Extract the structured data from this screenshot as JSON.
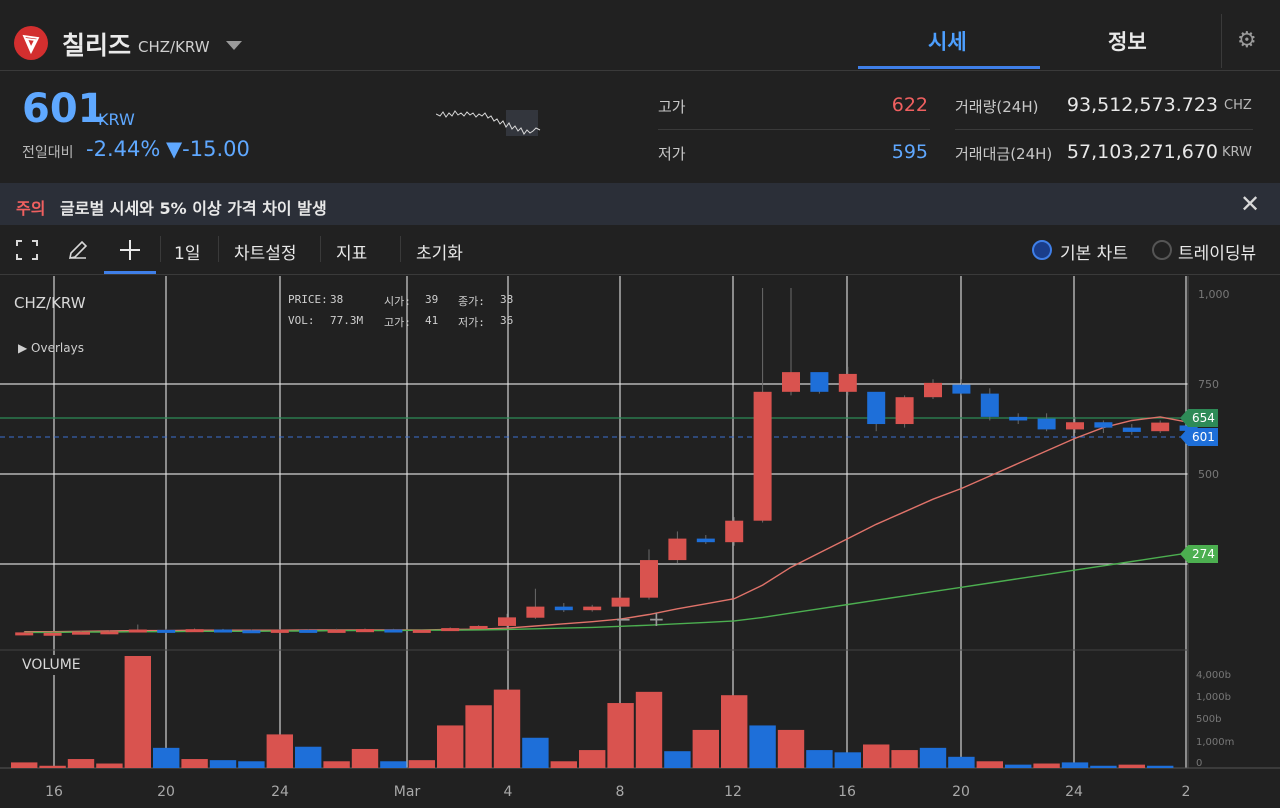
{
  "header": {
    "coin_name": "칠리즈",
    "pair": "CHZ/KRW",
    "tabs": [
      {
        "label": "시세",
        "active": true
      },
      {
        "label": "정보",
        "active": false
      }
    ]
  },
  "price": {
    "current": "601",
    "unit": "KRW",
    "change_label": "전일대비",
    "change_pct": "-2.44%",
    "change_amt": "▼-15.00",
    "high_label": "고가",
    "high": "622",
    "low_label": "저가",
    "low": "595",
    "volume_label": "거래량(24H)",
    "volume": "93,512,573.723",
    "volume_unit": "CHZ",
    "amount_label": "거래대금(24H)",
    "amount": "57,103,271,670",
    "amount_unit": "KRW"
  },
  "warning": {
    "tag": "주의",
    "text": "글로벌 시세와 5% 이상 가격 차이 발생"
  },
  "toolbar": {
    "interval": "1일",
    "chart_settings": "차트설정",
    "indicators": "지표",
    "reset": "초기화",
    "basic_chart": "기본 차트",
    "trading_view": "트레이딩뷰"
  },
  "colors": {
    "up": "#d9534f",
    "down": "#1e6fd9",
    "accent": "#3f7fe8",
    "ma_short": "#e0736a",
    "ma_long": "#4caf50",
    "hline": "#2e8b57"
  },
  "chart_data": {
    "type": "candlestick",
    "title": "CHZ/KRW",
    "overlays_label": "Overlays",
    "volume_label": "VOLUME",
    "info": {
      "price_label": "PRICE:",
      "price": "38",
      "open_label": "시가:",
      "open": "39",
      "close_label": "종가:",
      "close": "38",
      "vol_label": "VOL:",
      "vol": "77.3M",
      "high_label": "고가:",
      "high": "41",
      "low_label": "저가:",
      "low": "36"
    },
    "x_ticks": [
      "16",
      "20",
      "24",
      "Mar",
      "4",
      "8",
      "12",
      "16",
      "20",
      "24",
      "2"
    ],
    "y_ticks": [
      "1,000",
      "750",
      "500"
    ],
    "vol_ticks": [
      "4,000b",
      "1,000b",
      "500b",
      "1,000m",
      "0"
    ],
    "price_tags": {
      "ma_short": "654",
      "current": "601",
      "ma_long": "274"
    },
    "ylim": [
      0,
      1000
    ],
    "candles": [
      {
        "o": 36,
        "c": 38,
        "h": 40,
        "l": 34
      },
      {
        "o": 35,
        "c": 37,
        "h": 39,
        "l": 33
      },
      {
        "o": 37,
        "c": 40,
        "h": 42,
        "l": 36
      },
      {
        "o": 38,
        "c": 41,
        "h": 43,
        "l": 37
      },
      {
        "o": 40,
        "c": 46,
        "h": 60,
        "l": 38
      },
      {
        "o": 45,
        "c": 43,
        "h": 48,
        "l": 41
      },
      {
        "o": 44,
        "c": 47,
        "h": 49,
        "l": 42
      },
      {
        "o": 46,
        "c": 44,
        "h": 48,
        "l": 42
      },
      {
        "o": 44,
        "c": 42,
        "h": 46,
        "l": 40
      },
      {
        "o": 41,
        "c": 45,
        "h": 47,
        "l": 39
      },
      {
        "o": 45,
        "c": 43,
        "h": 47,
        "l": 41
      },
      {
        "o": 43,
        "c": 45,
        "h": 48,
        "l": 41
      },
      {
        "o": 44,
        "c": 47,
        "h": 49,
        "l": 42
      },
      {
        "o": 46,
        "c": 44,
        "h": 48,
        "l": 42
      },
      {
        "o": 44,
        "c": 45,
        "h": 47,
        "l": 42
      },
      {
        "o": 46,
        "c": 50,
        "h": 52,
        "l": 44
      },
      {
        "o": 50,
        "c": 56,
        "h": 58,
        "l": 48
      },
      {
        "o": 56,
        "c": 80,
        "h": 90,
        "l": 52
      },
      {
        "o": 79,
        "c": 110,
        "h": 160,
        "l": 76
      },
      {
        "o": 110,
        "c": 100,
        "h": 120,
        "l": 95
      },
      {
        "o": 100,
        "c": 110,
        "h": 115,
        "l": 96
      },
      {
        "o": 110,
        "c": 135,
        "h": 150,
        "l": 108
      },
      {
        "o": 135,
        "c": 240,
        "h": 270,
        "l": 130
      },
      {
        "o": 240,
        "c": 300,
        "h": 320,
        "l": 230
      },
      {
        "o": 300,
        "c": 290,
        "h": 310,
        "l": 285
      },
      {
        "o": 290,
        "c": 350,
        "h": 360,
        "l": 280
      },
      {
        "o": 350,
        "c": 710,
        "h": 1000,
        "l": 345
      },
      {
        "o": 710,
        "c": 765,
        "h": 1000,
        "l": 700
      },
      {
        "o": 765,
        "c": 710,
        "h": 760,
        "l": 705
      },
      {
        "o": 710,
        "c": 760,
        "h": 780,
        "l": 700
      },
      {
        "o": 710,
        "c": 620,
        "h": 650,
        "l": 600
      },
      {
        "o": 620,
        "c": 695,
        "h": 700,
        "l": 610
      },
      {
        "o": 695,
        "c": 735,
        "h": 745,
        "l": 690
      },
      {
        "o": 730,
        "c": 705,
        "h": 745,
        "l": 700
      },
      {
        "o": 705,
        "c": 640,
        "h": 720,
        "l": 630
      },
      {
        "o": 640,
        "c": 630,
        "h": 650,
        "l": 620
      },
      {
        "o": 635,
        "c": 605,
        "h": 650,
        "l": 600
      },
      {
        "o": 605,
        "c": 625,
        "h": 640,
        "l": 595
      },
      {
        "o": 625,
        "c": 610,
        "h": 630,
        "l": 595
      },
      {
        "o": 610,
        "c": 598,
        "h": 620,
        "l": 590
      },
      {
        "o": 600,
        "c": 624,
        "h": 630,
        "l": 595
      },
      {
        "o": 616,
        "c": 601,
        "h": 622,
        "l": 595
      }
    ],
    "volumes": [
      {
        "v": 0.05,
        "up": true
      },
      {
        "v": 0.02,
        "up": true
      },
      {
        "v": 0.08,
        "up": true
      },
      {
        "v": 0.04,
        "up": true
      },
      {
        "v": 1.0,
        "up": true
      },
      {
        "v": 0.18,
        "up": false
      },
      {
        "v": 0.08,
        "up": true
      },
      {
        "v": 0.07,
        "up": false
      },
      {
        "v": 0.06,
        "up": false
      },
      {
        "v": 0.3,
        "up": true
      },
      {
        "v": 0.19,
        "up": false
      },
      {
        "v": 0.06,
        "up": true
      },
      {
        "v": 0.17,
        "up": true
      },
      {
        "v": 0.06,
        "up": false
      },
      {
        "v": 0.07,
        "up": true
      },
      {
        "v": 0.38,
        "up": true
      },
      {
        "v": 0.56,
        "up": true
      },
      {
        "v": 0.7,
        "up": true
      },
      {
        "v": 0.27,
        "up": false
      },
      {
        "v": 0.06,
        "up": true
      },
      {
        "v": 0.16,
        "up": true
      },
      {
        "v": 0.58,
        "up": true
      },
      {
        "v": 0.68,
        "up": true
      },
      {
        "v": 0.15,
        "up": false
      },
      {
        "v": 0.34,
        "up": true
      },
      {
        "v": 0.65,
        "up": true
      },
      {
        "v": 0.38,
        "up": false
      },
      {
        "v": 0.34,
        "up": true
      },
      {
        "v": 0.16,
        "up": false
      },
      {
        "v": 0.14,
        "up": false
      },
      {
        "v": 0.21,
        "up": true
      },
      {
        "v": 0.16,
        "up": true
      },
      {
        "v": 0.18,
        "up": false
      },
      {
        "v": 0.1,
        "up": false
      },
      {
        "v": 0.06,
        "up": true
      },
      {
        "v": 0.03,
        "up": false
      },
      {
        "v": 0.04,
        "up": true
      },
      {
        "v": 0.05,
        "up": false
      },
      {
        "v": 0.02,
        "up": false
      },
      {
        "v": 0.03,
        "up": true
      },
      {
        "v": 0.02,
        "up": false
      }
    ],
    "ma_short": [
      40,
      40,
      41,
      42,
      43,
      43,
      44,
      44,
      44,
      44,
      45,
      45,
      45,
      45,
      45,
      46,
      47,
      50,
      56,
      62,
      68,
      75,
      88,
      104,
      118,
      132,
      170,
      220,
      260,
      300,
      340,
      375,
      410,
      440,
      475,
      510,
      545,
      580,
      610,
      630,
      640,
      625
    ],
    "ma_long": [
      38,
      38,
      39,
      39,
      40,
      40,
      41,
      41,
      41,
      42,
      42,
      43,
      43,
      43,
      44,
      44,
      45,
      46,
      48,
      50,
      52,
      55,
      58,
      62,
      66,
      70,
      80,
      92,
      104,
      116,
      128,
      140,
      152,
      164,
      176,
      188,
      200,
      212,
      224,
      236,
      248,
      260
    ]
  }
}
